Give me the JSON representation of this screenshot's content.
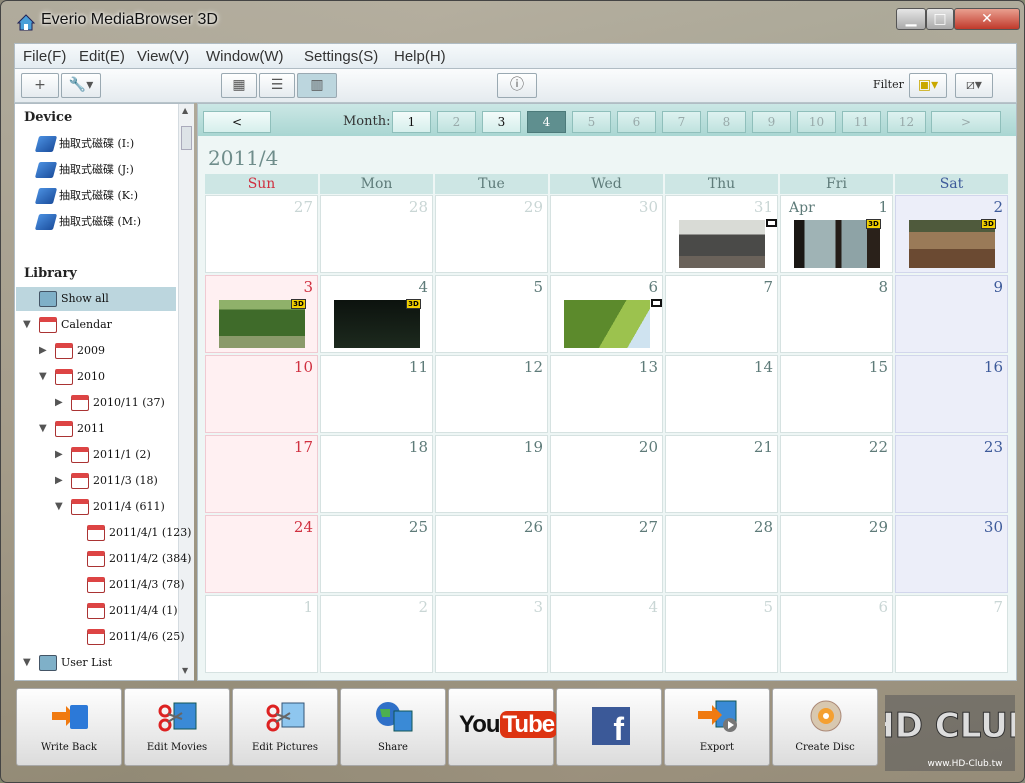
{
  "window": {
    "title": "Everio MediaBrowser 3D"
  },
  "menu": [
    "File(F)",
    "Edit(E)",
    "View(V)",
    "Window(W)",
    "Settings(S)",
    "Help(H)"
  ],
  "toolbar": {
    "filter_label": "Filter",
    "add_symbol": "+"
  },
  "sidebar": {
    "device_heading": "Device",
    "devices": [
      "抽取式磁碟 (I:)",
      "抽取式磁碟 (J:)",
      "抽取式磁碟 (K:)",
      "抽取式磁碟 (M:)"
    ],
    "library_heading": "Library",
    "library": [
      {
        "label": "Show all",
        "level": 0,
        "arrow": "",
        "icon": "show-all",
        "selected": true
      },
      {
        "label": "Calendar",
        "level": 0,
        "arrow": "▼",
        "icon": "calendar"
      },
      {
        "label": "2009",
        "level": 1,
        "arrow": "▶",
        "icon": "calendar"
      },
      {
        "label": "2010",
        "level": 1,
        "arrow": "▼",
        "icon": "calendar"
      },
      {
        "label": "2010/11 (37)",
        "level": 2,
        "arrow": "▶",
        "icon": "calendar"
      },
      {
        "label": "2011",
        "level": 1,
        "arrow": "▼",
        "icon": "calendar"
      },
      {
        "label": "2011/1 (2)",
        "level": 2,
        "arrow": "▶",
        "icon": "calendar"
      },
      {
        "label": "2011/3 (18)",
        "level": 2,
        "arrow": "▶",
        "icon": "calendar"
      },
      {
        "label": "2011/4 (611)",
        "level": 2,
        "arrow": "▼",
        "icon": "calendar"
      },
      {
        "label": "2011/4/1 (123)",
        "level": 3,
        "arrow": "",
        "icon": "calendar"
      },
      {
        "label": "2011/4/2 (384)",
        "level": 3,
        "arrow": "",
        "icon": "calendar"
      },
      {
        "label": "2011/4/3 (78)",
        "level": 3,
        "arrow": "",
        "icon": "calendar"
      },
      {
        "label": "2011/4/4 (1)",
        "level": 3,
        "arrow": "",
        "icon": "calendar"
      },
      {
        "label": "2011/4/6 (25)",
        "level": 3,
        "arrow": "",
        "icon": "calendar"
      },
      {
        "label": "User List",
        "level": 0,
        "arrow": "▼",
        "icon": "user-list"
      }
    ]
  },
  "calendar": {
    "month_label": "Month:",
    "prev": "<",
    "next": ">",
    "months": [
      "1",
      "2",
      "3",
      "4",
      "5",
      "6",
      "7",
      "8",
      "9",
      "10",
      "11",
      "12"
    ],
    "months_with_media": [
      "1",
      "3"
    ],
    "current_month": "4",
    "title": "2011/4",
    "weekdays": [
      "Sun",
      "Mon",
      "Tue",
      "Wed",
      "Thu",
      "Fri",
      "Sat"
    ],
    "month_marker": "Apr",
    "weeks": [
      [
        {
          "d": "27",
          "o": true
        },
        {
          "d": "28",
          "o": true
        },
        {
          "d": "29",
          "o": true
        },
        {
          "d": "30",
          "o": true
        },
        {
          "d": "31",
          "o": true,
          "thumb": "sofa",
          "badge": "photo"
        },
        {
          "d": "1",
          "marker": true,
          "thumb": "window",
          "badge": "3d"
        },
        {
          "d": "2",
          "thumb": "porch",
          "badge": "3d"
        }
      ],
      [
        {
          "d": "3",
          "thumb": "trees",
          "badge": "3d"
        },
        {
          "d": "4",
          "thumb": "dark",
          "badge": "3d"
        },
        {
          "d": "5"
        },
        {
          "d": "6",
          "thumb": "tree",
          "badge": "photo"
        },
        {
          "d": "7"
        },
        {
          "d": "8"
        },
        {
          "d": "9"
        }
      ],
      [
        {
          "d": "10"
        },
        {
          "d": "11"
        },
        {
          "d": "12"
        },
        {
          "d": "13"
        },
        {
          "d": "14"
        },
        {
          "d": "15"
        },
        {
          "d": "16"
        }
      ],
      [
        {
          "d": "17"
        },
        {
          "d": "18"
        },
        {
          "d": "19"
        },
        {
          "d": "20"
        },
        {
          "d": "21"
        },
        {
          "d": "22"
        },
        {
          "d": "23"
        }
      ],
      [
        {
          "d": "24"
        },
        {
          "d": "25"
        },
        {
          "d": "26"
        },
        {
          "d": "27"
        },
        {
          "d": "28"
        },
        {
          "d": "29"
        },
        {
          "d": "30"
        }
      ],
      [
        {
          "d": "1",
          "o": true
        },
        {
          "d": "2",
          "o": true
        },
        {
          "d": "3",
          "o": true
        },
        {
          "d": "4",
          "o": true
        },
        {
          "d": "5",
          "o": true
        },
        {
          "d": "6",
          "o": true
        },
        {
          "d": "7",
          "o": true
        }
      ]
    ],
    "badge_3d_text": "3D"
  },
  "actions": [
    {
      "label": "Write Back",
      "icon": "write-back"
    },
    {
      "label": "Edit Movies",
      "icon": "edit-movies"
    },
    {
      "label": "Edit Pictures",
      "icon": "edit-pictures"
    },
    {
      "label": "Share",
      "icon": "share"
    },
    {
      "label": "",
      "icon": "youtube",
      "text": "YouTube"
    },
    {
      "label": "",
      "icon": "facebook",
      "text": "f"
    },
    {
      "label": "Export",
      "icon": "export"
    },
    {
      "label": "Create Disc",
      "icon": "create-disc"
    }
  ],
  "watermark": {
    "text": "HD CLUB",
    "url": "www.HD-Club.tw"
  },
  "colors": {
    "accent": "#5f8f8f",
    "sunday": "#d03040",
    "saturday": "#3d5a9a"
  }
}
